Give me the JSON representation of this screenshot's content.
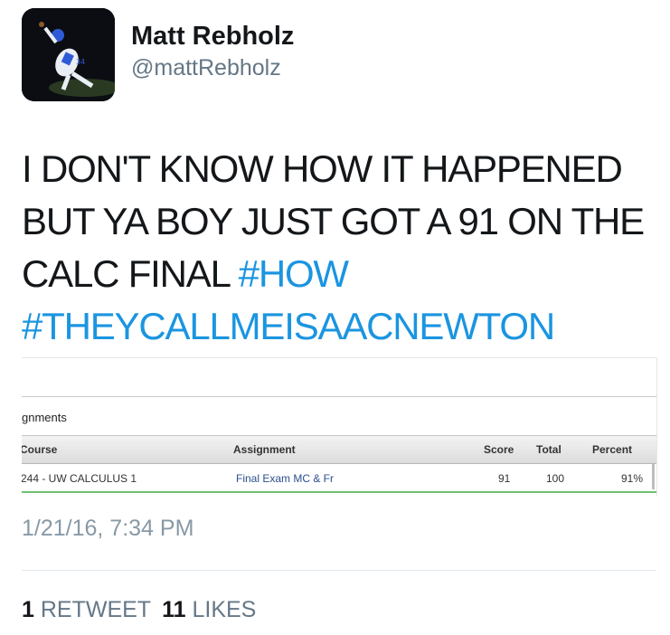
{
  "user": {
    "name": "Matt Rebholz",
    "handle": "@mattRebholz"
  },
  "tweet": {
    "text_line1": "I DON'T KNOW HOW IT HAPPENED",
    "text_line2": "BUT YA BOY JUST GOT A 91 ON THE",
    "text_line3_plain": "CALC FINAL ",
    "hashtag1": "#HOW",
    "hashtag2": "#THEYCALLMEISAACNEWTON"
  },
  "media": {
    "section_title": "gnments",
    "columns": {
      "course": "Course",
      "assignment": "Assignment",
      "score": "Score",
      "total": "Total",
      "percent": "Percent"
    },
    "row": {
      "course": "244 - UW CALCULUS 1",
      "assignment": "Final Exam MC & Fr",
      "score": "91",
      "total": "100",
      "percent": "91%"
    }
  },
  "timestamp": "1/21/16, 7:34 PM",
  "stats": {
    "retweets_count": "1",
    "retweets_label": "RETWEET",
    "likes_count": "11",
    "likes_label": "LIKES"
  },
  "colors": {
    "hashtag": "#1b95e0",
    "secondary_text": "#657786",
    "timestamp": "#8899a6",
    "row_accent": "#6fbf73"
  }
}
